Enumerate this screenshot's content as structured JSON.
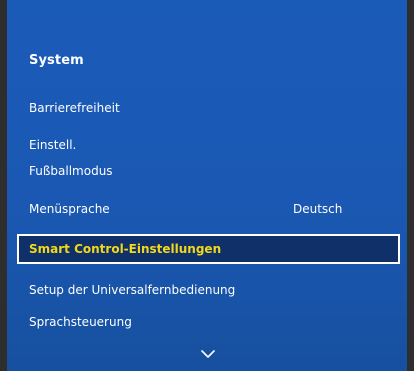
{
  "menu": {
    "title": "System",
    "items": [
      {
        "label": "Barrierefreiheit",
        "value": ""
      },
      {
        "label": "Einstell.",
        "value": ""
      },
      {
        "label": "Fußballmodus",
        "value": ""
      },
      {
        "label": "Menüsprache",
        "value": "Deutsch"
      },
      {
        "label": "Smart Control-Einstellungen",
        "value": ""
      },
      {
        "label": "Setup der Universalfernbedienung",
        "value": ""
      },
      {
        "label": "Sprachsteuerung",
        "value": ""
      }
    ],
    "selected_index": 4,
    "scroll_indicator_icon": "chevron-down-icon"
  },
  "colors": {
    "panel_background": "#1b5bb8",
    "selected_background": "#0f3068",
    "selected_text": "#f2d81c",
    "text": "#ffffff"
  }
}
